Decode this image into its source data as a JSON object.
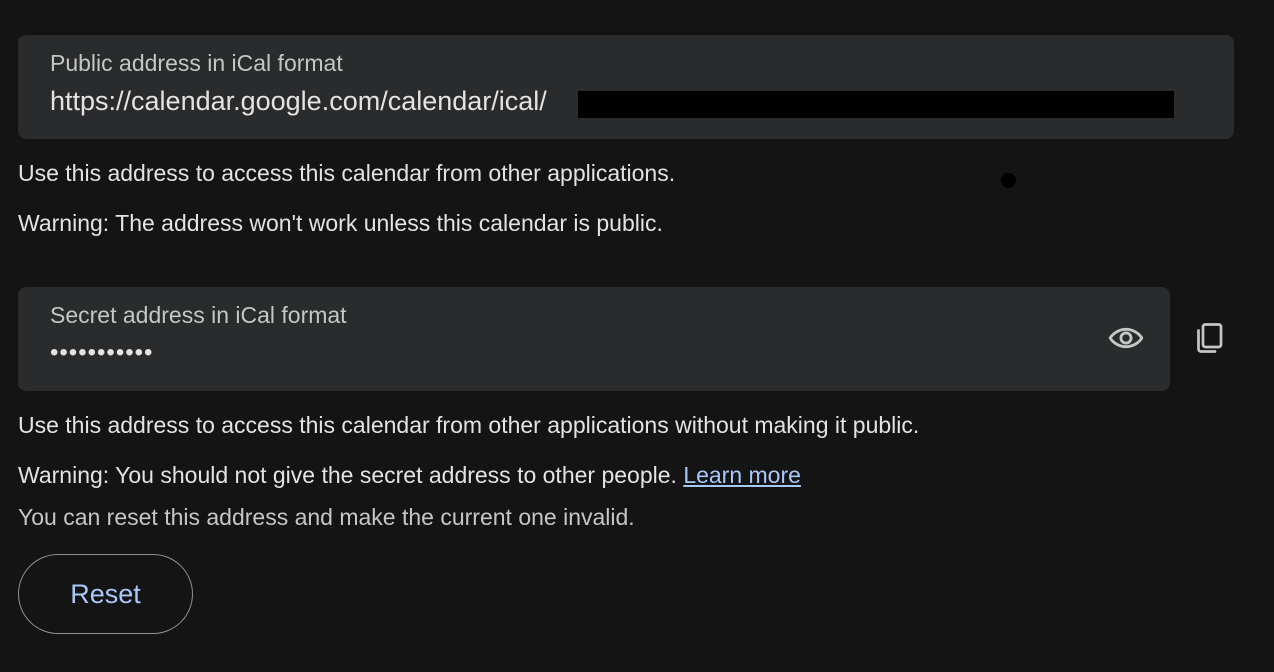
{
  "public_address": {
    "label": "Public address in iCal format",
    "value": "https://calendar.google.com/calendar/ical/",
    "help": "Use this address to access this calendar from other applications.",
    "warning": "Warning: The address won't work unless this calendar is public."
  },
  "secret_address": {
    "label": "Secret address in iCal format",
    "value": "•••••••••••",
    "help": "Use this address to access this calendar from other applications without making it public.",
    "warning": "Warning: You should not give the secret address to other people.",
    "learn_more": "Learn more",
    "reset_note": "You can reset this address and make the current one invalid.",
    "show_icon": "eye-icon",
    "copy_icon": "copy-icon"
  },
  "reset_button": {
    "label": "Reset"
  },
  "colors": {
    "background": "#141414",
    "field_background": "#2a2b2d",
    "accent": "#a8c7fa",
    "text": "#e3e3e3",
    "muted_text": "#c4c7c5"
  }
}
